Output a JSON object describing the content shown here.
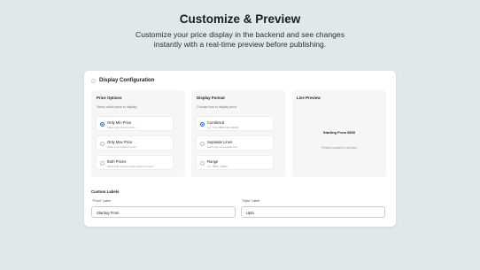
{
  "hero": {
    "title": "Customize & Preview",
    "subtitle_line1": "Customize your price display in the backend and see changes",
    "subtitle_line2": "instantly with a real-time preview before publishing."
  },
  "config": {
    "title": "Display Configuration",
    "price_options": {
      "title": "Price Options",
      "description": "Select which price to display:",
      "selected": "Only Min Price",
      "items": [
        {
          "label": "Only Min Price",
          "hint": "Show only minimum price"
        },
        {
          "label": "Only Max Price",
          "hint": "Show only maximum price"
        },
        {
          "label": "Both Prices",
          "hint": "Show both minimum and maximum prices"
        }
      ]
    },
    "display_format": {
      "title": "Display Format",
      "description": "Choose how to display price:",
      "selected": "Combined",
      "items": [
        {
          "label": "Combined",
          "hint": "e.g., From $500 Upto $1000"
        },
        {
          "label": "Separate Lines",
          "hint": "Each price on separate line"
        },
        {
          "label": "Range",
          "hint": "e.g., $500 - $1000"
        }
      ]
    },
    "live_preview": {
      "title": "Live Preview",
      "price_text": "Starting From $500",
      "note": "Preview updates in real-time"
    },
    "custom_labels": {
      "title": "Custom Labels",
      "from_label": "\"From\" Label",
      "from_value": "Starting From",
      "upto_label": "\"Upto\" Label",
      "upto_value": "Upto"
    }
  },
  "colors": {
    "background": "#dfe8ea",
    "accent": "#2c6ecb"
  }
}
